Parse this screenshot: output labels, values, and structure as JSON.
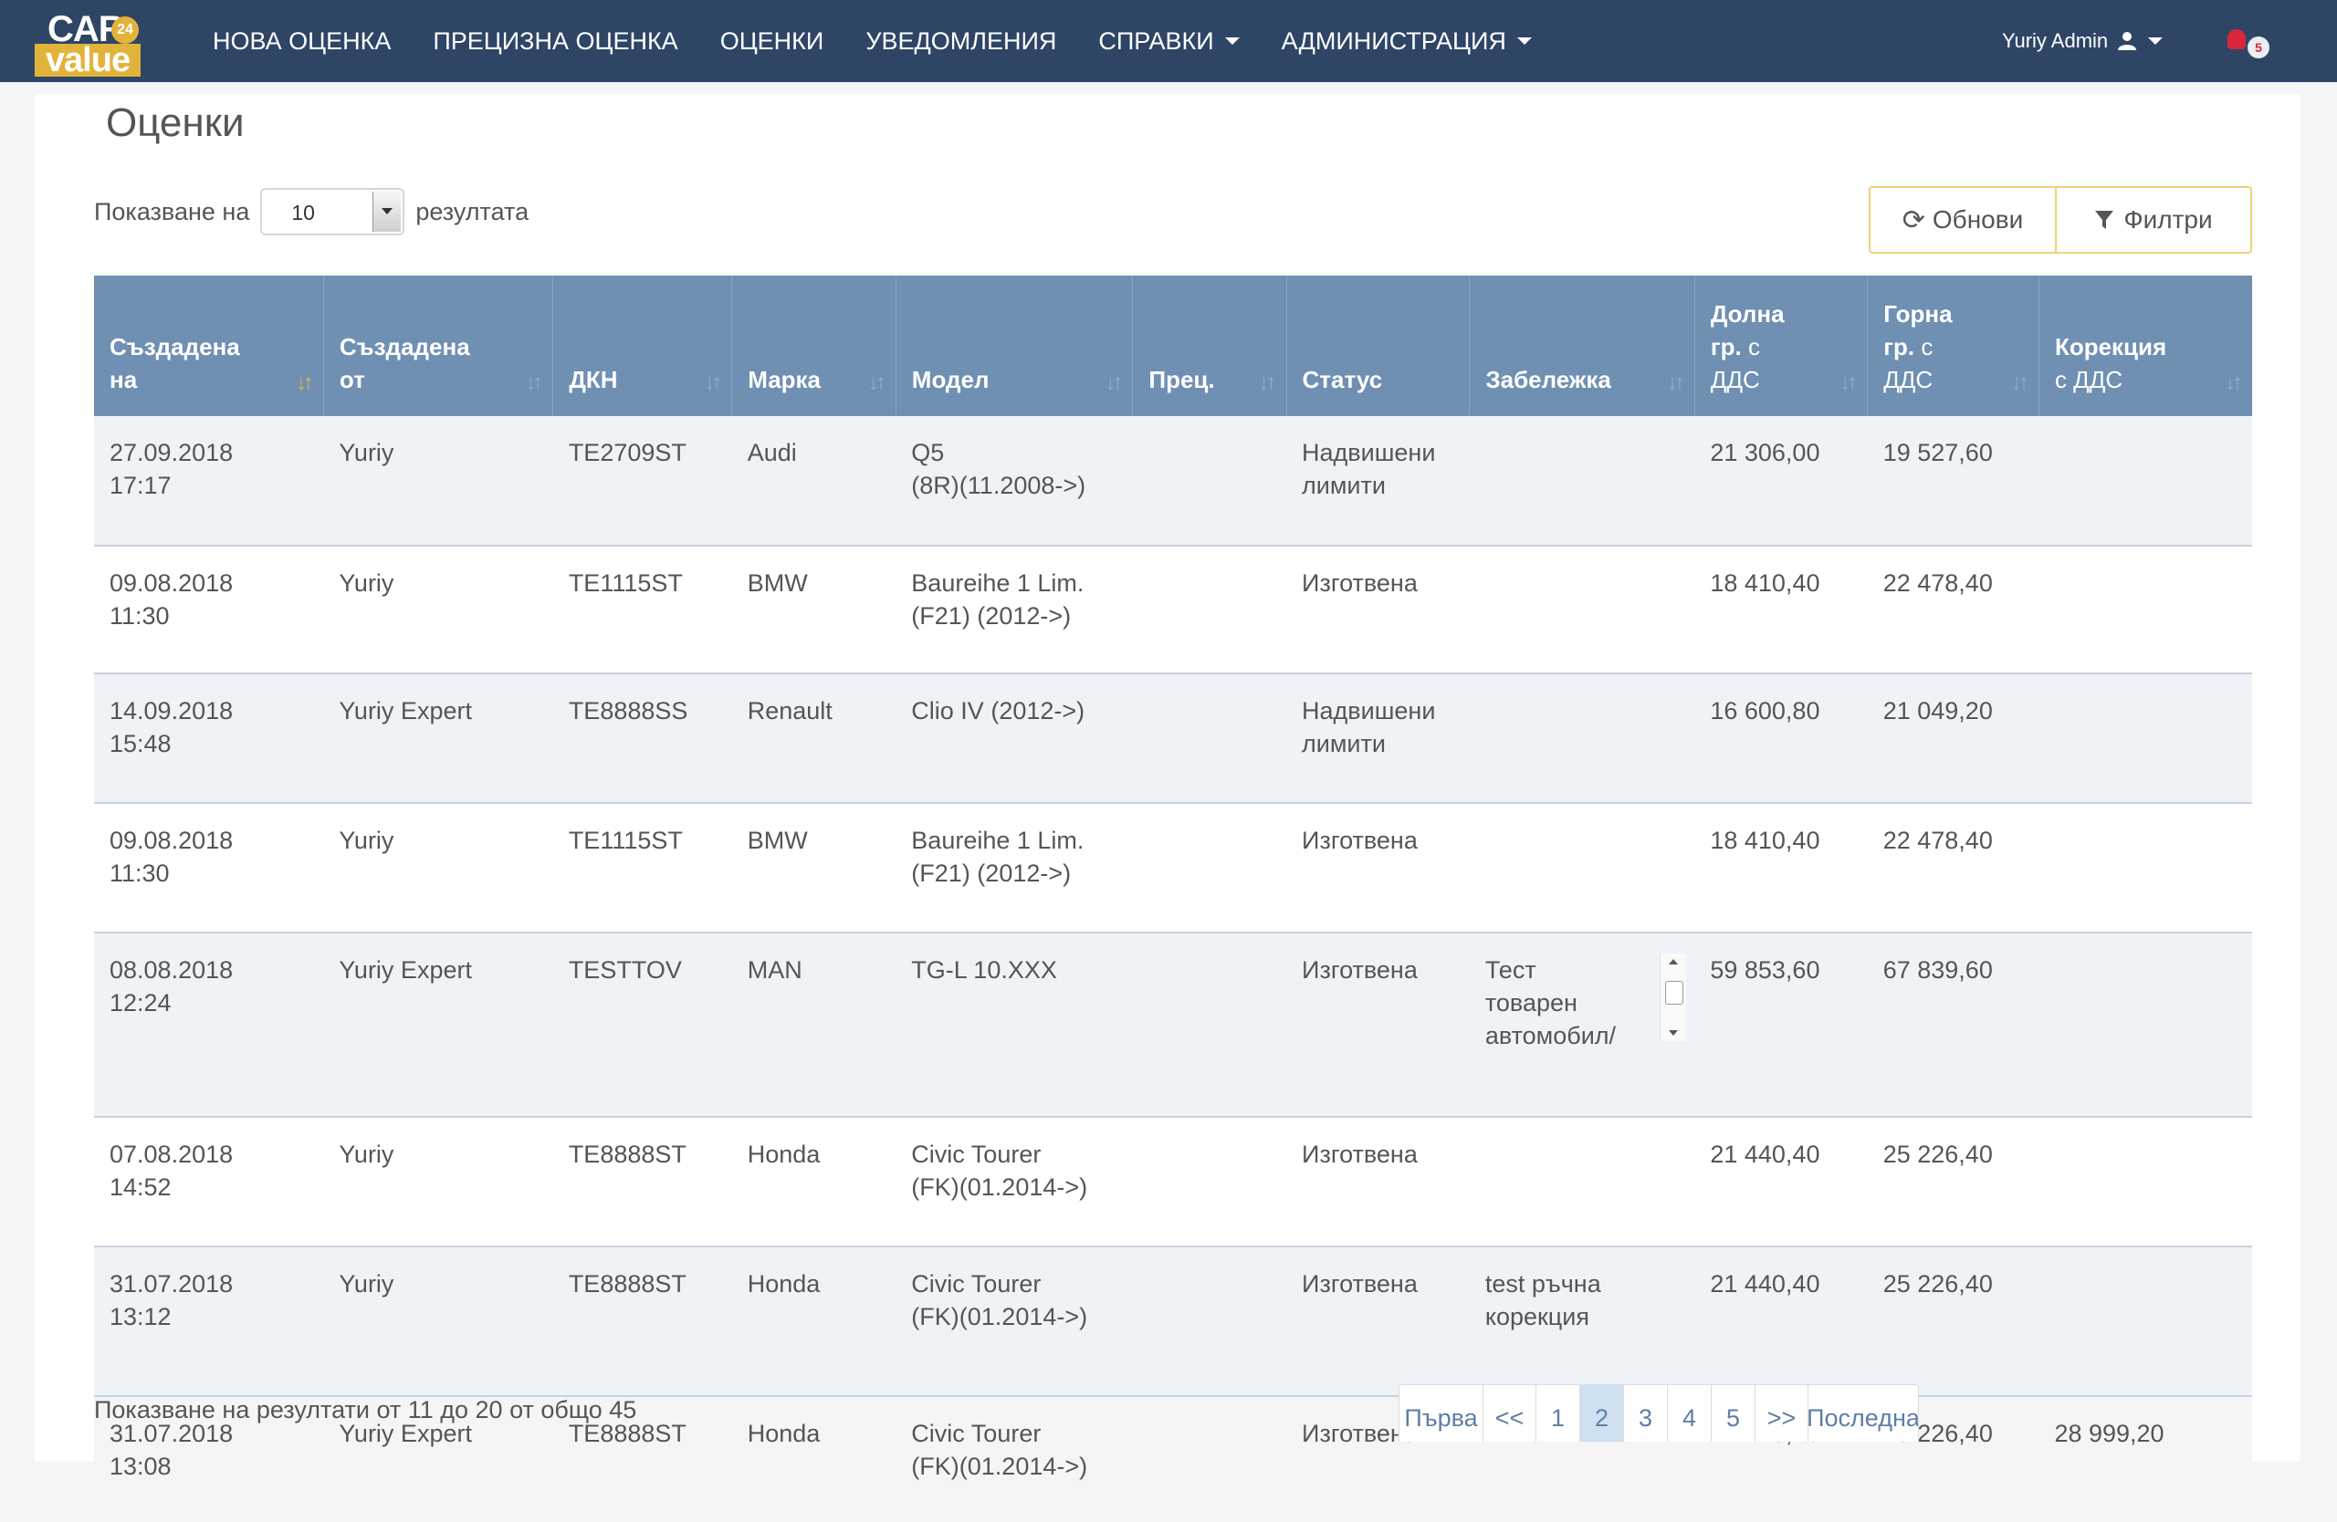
{
  "brand": {
    "top": "CAR",
    "badge": "24",
    "bottom": "value"
  },
  "nav": {
    "items": [
      {
        "label": "НОВА ОЦЕНКА"
      },
      {
        "label": "ПРЕЦИЗНА ОЦЕНКА"
      },
      {
        "label": "ОЦЕНКИ"
      },
      {
        "label": "УВЕДОМЛЕНИЯ"
      },
      {
        "label": "СПРАВКИ"
      },
      {
        "label": "АДМИНИСТРАЦИЯ"
      }
    ],
    "user": "Yuriy Admin",
    "notifications_count": "5"
  },
  "page": {
    "title": "Оценки",
    "length_prefix": "Показване на",
    "length_value": "10",
    "length_suffix": "резултата",
    "refresh_label": "Обнови",
    "filter_label": "Филтри"
  },
  "table": {
    "headers": [
      {
        "line1": "Създадена",
        "line2": "на",
        "line3": ""
      },
      {
        "line1": "Създадена",
        "line2": "от",
        "line3": ""
      },
      {
        "line1": "",
        "line2": "ДКН",
        "line3": ""
      },
      {
        "line1": "",
        "line2": "Марка",
        "line3": ""
      },
      {
        "line1": "",
        "line2": "Модел",
        "line3": ""
      },
      {
        "line1": "",
        "line2": "Прец.",
        "line3": ""
      },
      {
        "line1": "",
        "line2": "Статус",
        "line3": ""
      },
      {
        "line1": "",
        "line2": "Забележка",
        "line3": ""
      },
      {
        "line1": "Долна",
        "line2": "гр.",
        "line2_sub": " с",
        "line3": "ДДС"
      },
      {
        "line1": "Горна",
        "line2": "гр.",
        "line2_sub": " с",
        "line3": "ДДС"
      },
      {
        "line1": "Корекция",
        "line2": "",
        "line2_sub": "с ДДС",
        "line3": ""
      }
    ],
    "rows": [
      {
        "date": "27.09.2018",
        "time": "17:17",
        "by": "Yuriy",
        "dkn": "TE2709ST",
        "make": "Audi",
        "model1": "Q5",
        "model2": "(8R)(11.2008->)",
        "prec": "",
        "status1": "Надвишени",
        "status2": "лимити",
        "note": "",
        "low": "21 306,00",
        "high": "19 527,60",
        "corr": ""
      },
      {
        "date": "09.08.2018",
        "time": "11:30",
        "by": "Yuriy",
        "dkn": "TE1115ST",
        "make": "BMW",
        "model1": "Baureihe 1 Lim.",
        "model2": "(F21) (2012->)",
        "prec": "",
        "status1": "Изготвена",
        "status2": "",
        "note": "",
        "low": "18 410,40",
        "high": "22 478,40",
        "corr": ""
      },
      {
        "date": "14.09.2018",
        "time": "15:48",
        "by": "Yuriy Expert",
        "dkn": "TE8888SS",
        "make": "Renault",
        "model1": "Clio IV (2012->)",
        "model2": "",
        "prec": "",
        "status1": "Надвишени",
        "status2": "лимити",
        "note": "",
        "low": "16 600,80",
        "high": "21 049,20",
        "corr": ""
      },
      {
        "date": "09.08.2018",
        "time": "11:30",
        "by": "Yuriy",
        "dkn": "TE1115ST",
        "make": "BMW",
        "model1": "Baureihe 1 Lim.",
        "model2": "(F21) (2012->)",
        "prec": "",
        "status1": "Изготвена",
        "status2": "",
        "note": "",
        "low": "18 410,40",
        "high": "22 478,40",
        "corr": ""
      },
      {
        "date": "08.08.2018",
        "time": "12:24",
        "by": "Yuriy Expert",
        "dkn": "TESTTOV",
        "make": "MAN",
        "model1": "TG-L 10.XXX",
        "model2": "",
        "prec": "",
        "status1": "Изготвена",
        "status2": "",
        "note1": "Тест",
        "note2": "товарен",
        "note3": "автомобил/",
        "low": "59 853,60",
        "high": "67 839,60",
        "corr": ""
      },
      {
        "date": "07.08.2018",
        "time": "14:52",
        "by": "Yuriy",
        "dkn": "TE8888ST",
        "make": "Honda",
        "model1": "Civic Tourer",
        "model2": "(FK)(01.2014->)",
        "prec": "",
        "status1": "Изготвена",
        "status2": "",
        "note": "",
        "low": "21 440,40",
        "high": "25 226,40",
        "corr": ""
      },
      {
        "date": "31.07.2018",
        "time": "13:12",
        "by": "Yuriy",
        "dkn": "TE8888ST",
        "make": "Honda",
        "model1": "Civic Tourer",
        "model2": "(FK)(01.2014->)",
        "prec": "",
        "status1": "Изготвена",
        "status2": "",
        "note1": "test ръчна",
        "note2": "корекция",
        "low": "21 440,40",
        "high": "25 226,40",
        "corr": ""
      },
      {
        "date": "31.07.2018",
        "time": "13:08",
        "by": "Yuriy Expert",
        "dkn": "TE8888ST",
        "make": "Honda",
        "model1": "Civic Tourer",
        "model2": "(FK)(01.2014->)",
        "prec": "",
        "status1": "Изготвена",
        "status2": "",
        "note": "",
        "low": "21 440,40",
        "high": "25 226,40",
        "corr": "28 999,20"
      }
    ]
  },
  "footer": {
    "info": "Показване на резултати от 11 до 20 от общо 45",
    "pages": [
      {
        "label": "Първа"
      },
      {
        "label": "<<"
      },
      {
        "label": "1"
      },
      {
        "label": "2"
      },
      {
        "label": "3"
      },
      {
        "label": "4"
      },
      {
        "label": "5"
      },
      {
        "label": ">>"
      },
      {
        "label": "Последна"
      }
    ],
    "current_page": "2"
  },
  "colors": {
    "navbar": "#2f4566",
    "header": "#6f8fb3",
    "accent": "#e2b33a",
    "badge": "#d9263b"
  }
}
